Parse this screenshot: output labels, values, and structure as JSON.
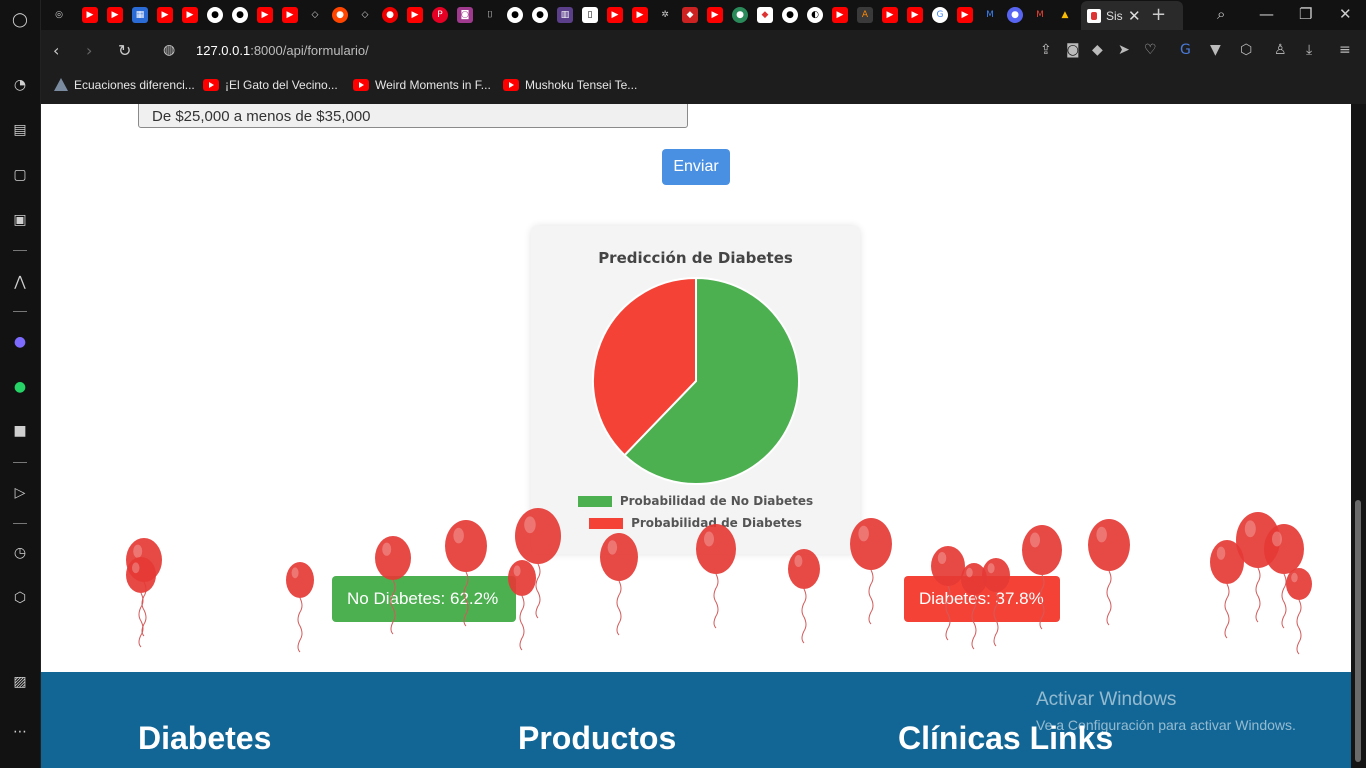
{
  "browser": {
    "active_tab_title": "Sis",
    "url_host": "127.0.0.1",
    "url_path": ":8000/api/formulario/",
    "bookmarks": [
      {
        "label": "Ecuaciones diferenci...",
        "icon": "matlab-icon"
      },
      {
        "label": "¡El Gato del Vecino...",
        "icon": "youtube-icon"
      },
      {
        "label": "Weird Moments in F...",
        "icon": "youtube-icon"
      },
      {
        "label": "Mushoku Tensei Te...",
        "icon": "youtube-icon"
      }
    ]
  },
  "form": {
    "income_value": "De $25,000 a menos de $35,000",
    "submit_label": "Enviar"
  },
  "chart_data": {
    "type": "pie",
    "title": "Predicción de Diabetes",
    "labels": [
      "Probabilidad de No Diabetes",
      "Probabilidad de Diabetes"
    ],
    "values": [
      62.2,
      37.8
    ],
    "colors": [
      "#4caf50",
      "#f44336"
    ],
    "legend_position": "bottom"
  },
  "results": {
    "no_diabetes": "No Diabetes: 62.2%",
    "diabetes": "Diabetes: 37.8%"
  },
  "footer": {
    "col1": "Diabetes",
    "col2": "Productos",
    "col3": "Clínicas Links"
  },
  "watermark": {
    "line1": "Activar Windows",
    "line2": "Ve a Configuración para activar Windows."
  },
  "colors": {
    "accent_blue": "#4a90e2",
    "footer_blue": "#126696",
    "balloon_red": "#e53935"
  }
}
